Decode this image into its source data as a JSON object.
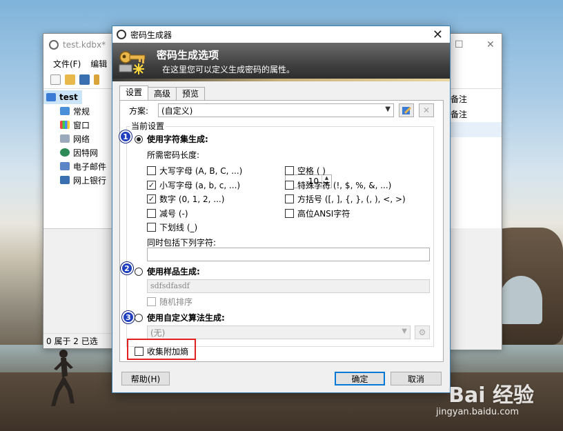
{
  "bg_window": {
    "title": "test.kdbx*",
    "menu": [
      "文件(F)",
      "编辑"
    ],
    "tree": [
      {
        "label": "test",
        "root": true,
        "color": "#3a7bd5"
      },
      {
        "label": "常规",
        "color": "#4a90d9"
      },
      {
        "label": "窗口",
        "color": "#6a6a6a"
      },
      {
        "label": "网络",
        "color": "#5b7aa0"
      },
      {
        "label": "因特网",
        "color": "#2e8b57"
      },
      {
        "label": "电子邮件",
        "color": "#5a86c8"
      },
      {
        "label": "网上银行",
        "color": "#3a6fb0"
      }
    ],
    "status": "0 属于 2 已选",
    "right_col": [
      "备注",
      "备注"
    ]
  },
  "dialog": {
    "title": "密码生成器",
    "banner_title": "密码生成选项",
    "banner_subtitle": "在这里您可以定义生成密码的属性。",
    "tabs": [
      "设置",
      "高级",
      "预览"
    ],
    "active_tab": 0,
    "profile_label": "方案:",
    "profile_value": "(自定义)",
    "group_label": "当前设置",
    "charset": {
      "label": "使用字符集生成:",
      "badge": "1",
      "length_label": "所需密码长度:",
      "length_value": "10",
      "options_left": [
        {
          "label": "大写字母 (A, B, C, ...)",
          "checked": false
        },
        {
          "label": "小写字母 (a, b, c, ...)",
          "checked": true
        },
        {
          "label": "数字 (0, 1, 2, ...)",
          "checked": true
        },
        {
          "label": "减号 (-)",
          "checked": false
        },
        {
          "label": "下划线 (_)",
          "checked": false
        }
      ],
      "options_right": [
        {
          "label": "空格 ( )",
          "checked": false
        },
        {
          "label": "特殊字符 (!, $, %, &, ...)",
          "checked": false
        },
        {
          "label": "方括号 ([, ], {, }, (, ), <, >)",
          "checked": false
        },
        {
          "label": "高位ANSI字符",
          "checked": false
        }
      ],
      "include_label": "同时包括下列字符:",
      "include_value": ""
    },
    "pattern": {
      "label": "使用样品生成:",
      "badge": "2",
      "value": "sdfsdfasdf",
      "shuffle_label": "随机排序"
    },
    "custom": {
      "label": "使用自定义算法生成:",
      "badge": "3",
      "value": "(无)"
    },
    "entropy_label": "收集附加熵",
    "help_button": "帮助(H)",
    "ok_button": "确定",
    "cancel_button": "取消"
  },
  "watermark": {
    "main": "Bai 经验",
    "sub": "jingyan.baidu.com"
  },
  "colors": {
    "highlight": "#e0201e",
    "badge": "#1f3fbf",
    "accent": "#0078d7"
  }
}
